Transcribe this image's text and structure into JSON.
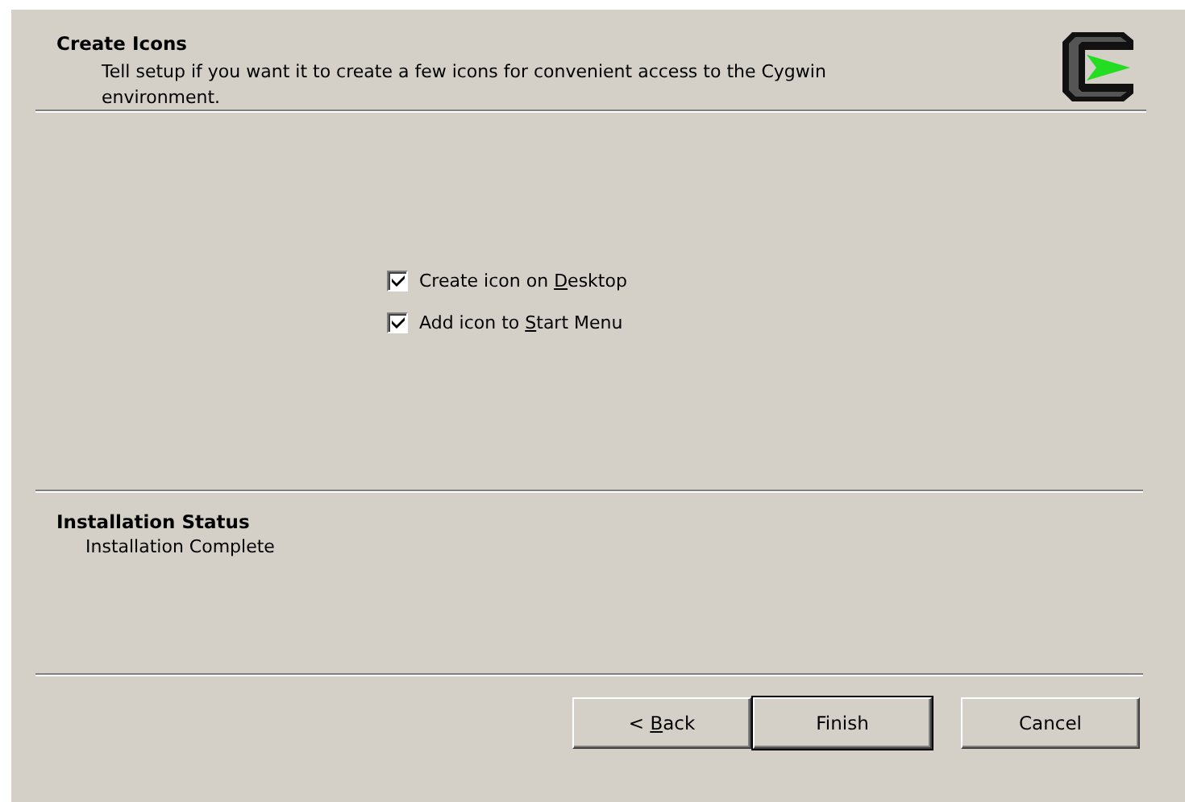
{
  "header": {
    "title": "Create Icons",
    "description": "Tell setup if you want it to create a few icons for convenient access to the Cygwin environment."
  },
  "options": [
    {
      "label": [
        "Create icon on ",
        "D",
        "esktop"
      ],
      "checked": true
    },
    {
      "label": [
        "Add icon to ",
        "S",
        "tart Menu"
      ],
      "checked": true
    }
  ],
  "status": {
    "title": "Installation Status",
    "text": "Installation Complete"
  },
  "buttons": [
    {
      "label": [
        "< ",
        "B",
        "ack"
      ],
      "default": false
    },
    {
      "label": [
        "Finish"
      ],
      "default": true
    },
    {
      "label": [
        "Cancel"
      ],
      "default": false
    }
  ]
}
